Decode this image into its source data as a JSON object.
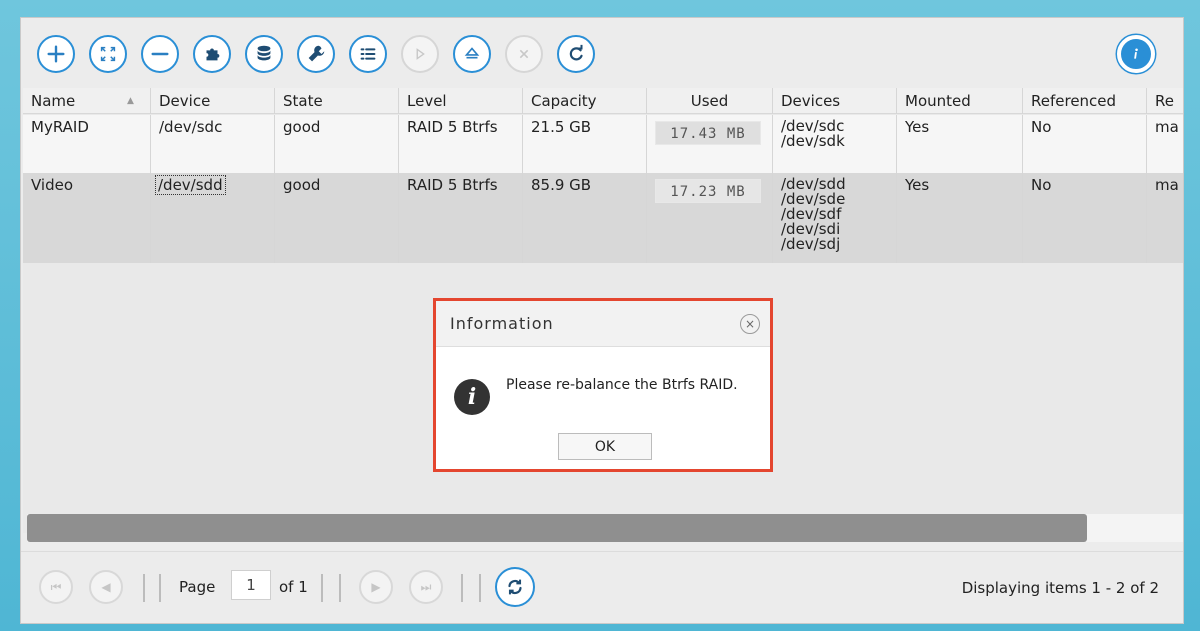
{
  "toolbar": {
    "buttons": [
      {
        "name": "add",
        "icon": "plus-icon",
        "enabled": true
      },
      {
        "name": "expand",
        "icon": "expand-icon",
        "enabled": true
      },
      {
        "name": "remove",
        "icon": "minus-icon",
        "enabled": true
      },
      {
        "name": "plugin",
        "icon": "puzzle-icon",
        "enabled": true
      },
      {
        "name": "database",
        "icon": "database-icon",
        "enabled": true
      },
      {
        "name": "settings",
        "icon": "wrench-icon",
        "enabled": true
      },
      {
        "name": "details",
        "icon": "list-icon",
        "enabled": true
      },
      {
        "name": "play",
        "icon": "play-icon",
        "enabled": false
      },
      {
        "name": "eject",
        "icon": "eject-icon",
        "enabled": true
      },
      {
        "name": "cancel",
        "icon": "close-icon",
        "enabled": false
      },
      {
        "name": "refresh",
        "icon": "refresh-icon",
        "enabled": true
      },
      {
        "name": "info",
        "icon": "info-icon",
        "enabled": true
      }
    ]
  },
  "grid": {
    "columns": [
      "Name",
      "Device",
      "State",
      "Level",
      "Capacity",
      "Used",
      "Devices",
      "Mounted",
      "Referenced",
      "Re"
    ],
    "rows": [
      {
        "name": "MyRAID",
        "device": "/dev/sdc",
        "state": "good",
        "level": "RAID 5 Btrfs",
        "capacity": "21.5 GB",
        "used": "17.43 MB",
        "devices": [
          "/dev/sdc",
          "/dev/sdk"
        ],
        "mounted": "Yes",
        "referenced": "No",
        "re": "ma"
      },
      {
        "name": "Video",
        "device": "/dev/sdd",
        "state": "good",
        "level": "RAID 5 Btrfs",
        "capacity": "85.9 GB",
        "used": "17.23 MB",
        "devices": [
          "/dev/sdd",
          "/dev/sde",
          "/dev/sdf",
          "/dev/sdi",
          "/dev/sdj"
        ],
        "mounted": "Yes",
        "referenced": "No",
        "re": "ma"
      }
    ]
  },
  "dialog": {
    "title": "Information",
    "message": "Please re-balance the Btrfs RAID.",
    "ok_label": "OK",
    "close_symbol": "×",
    "icon_glyph": "i"
  },
  "pager": {
    "page_label": "Page",
    "page_value": "1",
    "of_label": "of 1",
    "display_text": "Displaying items 1 - 2 of 2"
  },
  "colors": {
    "accent": "#2a8fd6",
    "dialog_border": "#e4462f",
    "desktop": "#5bbcd8"
  }
}
